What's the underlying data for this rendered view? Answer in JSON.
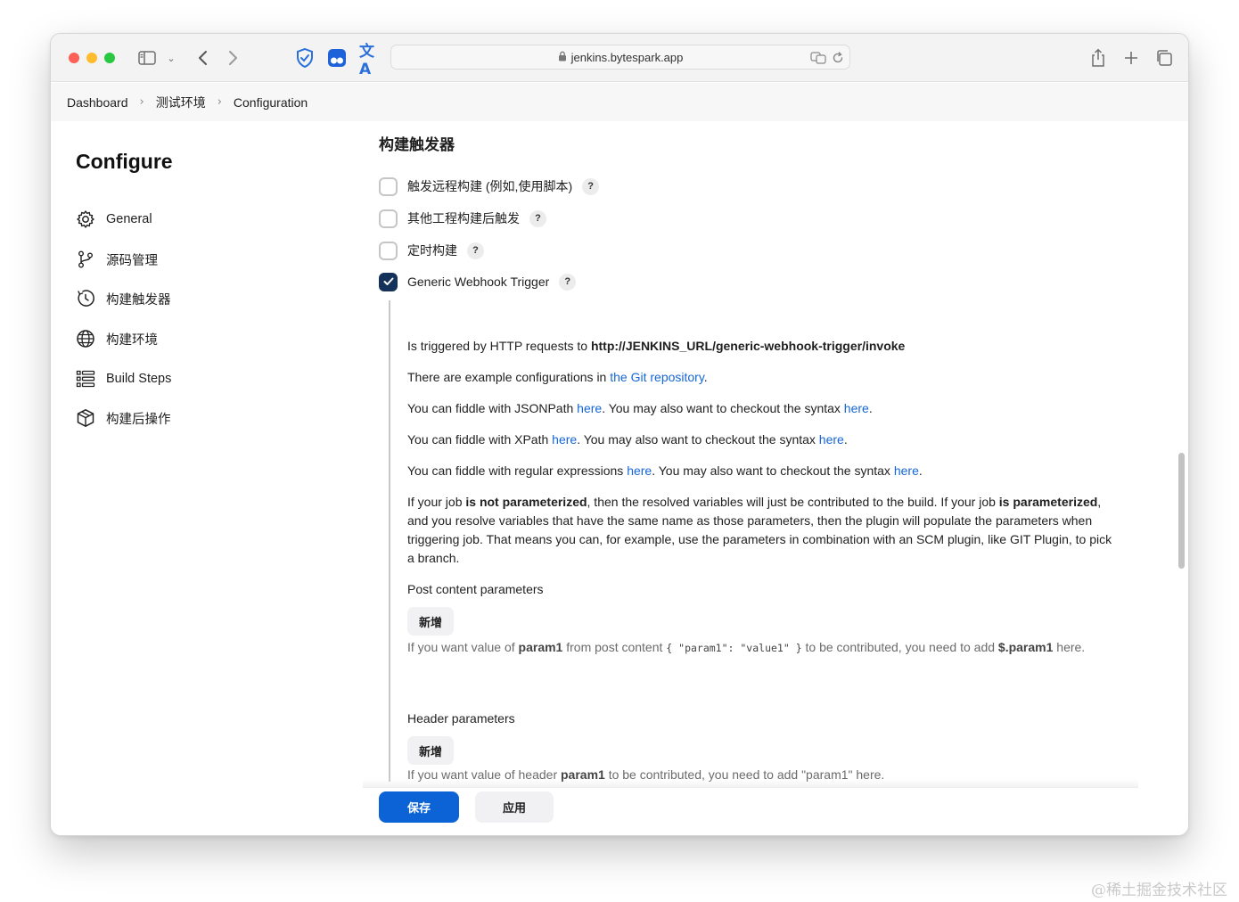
{
  "browser": {
    "url": "jenkins.bytespark.app"
  },
  "breadcrumb": [
    "Dashboard",
    "测试环境",
    "Configuration"
  ],
  "sidebar": {
    "title": "Configure",
    "items": [
      {
        "label": "General",
        "icon": "gear-icon"
      },
      {
        "label": "源码管理",
        "icon": "git-branch-icon"
      },
      {
        "label": "构建触发器",
        "icon": "clock-icon"
      },
      {
        "label": "构建环境",
        "icon": "globe-icon"
      },
      {
        "label": "Build Steps",
        "icon": "list-icon"
      },
      {
        "label": "构建后操作",
        "icon": "package-icon"
      }
    ]
  },
  "main": {
    "section_title": "构建触发器",
    "triggers": [
      {
        "label": "触发远程构建 (例如,使用脚本)",
        "checked": false
      },
      {
        "label": "其他工程构建后触发",
        "checked": false
      },
      {
        "label": "定时构建",
        "checked": false
      },
      {
        "label": "Generic Webhook Trigger",
        "checked": true
      }
    ],
    "help_label": "?",
    "webhook": {
      "line1_pre": "Is triggered by HTTP requests to ",
      "line1_url": "http://JENKINS_URL/generic-webhook-trigger/invoke",
      "line2_pre": "There are example configurations in ",
      "line2_link": "the Git repository",
      "line2_post": ".",
      "jsonpath_pre": "You can fiddle with JSONPath ",
      "xpath_pre": "You can fiddle with XPath ",
      "regex_pre": "You can fiddle with regular expressions ",
      "here": "here",
      "syntax_mid": ". You may also want to checkout the syntax ",
      "dot": ".",
      "param_p1": "If your job ",
      "param_b1": "is not parameterized",
      "param_p2": ", then the resolved variables will just be contributed to the build. If your job ",
      "param_b2": "is parameterized",
      "param_p3": ", and you resolve variables that have the same name as those parameters, then the plugin will populate the parameters when triggering job. That means you can, for example, use the parameters in combination with an SCM plugin, like GIT Plugin, to pick a branch.",
      "post_title": "Post content parameters",
      "add_label": "新增",
      "post_help_pre": "If you want value of ",
      "post_help_b1": "param1",
      "post_help_mid": " from post content ",
      "post_help_code": "{ \"param1\": \"value1\" }",
      "post_help_mid2": " to be contributed, you need to add ",
      "post_help_b2": "$.param1",
      "post_help_end": " here.",
      "header_title": "Header parameters",
      "header_help_pre": "If you want value of header ",
      "header_help_b": "param1",
      "header_help_post": " to be contributed, you need to add \"param1\" here."
    }
  },
  "footer": {
    "save_label": "保存",
    "apply_label": "应用"
  },
  "watermark": "@稀土掘金技术社区"
}
